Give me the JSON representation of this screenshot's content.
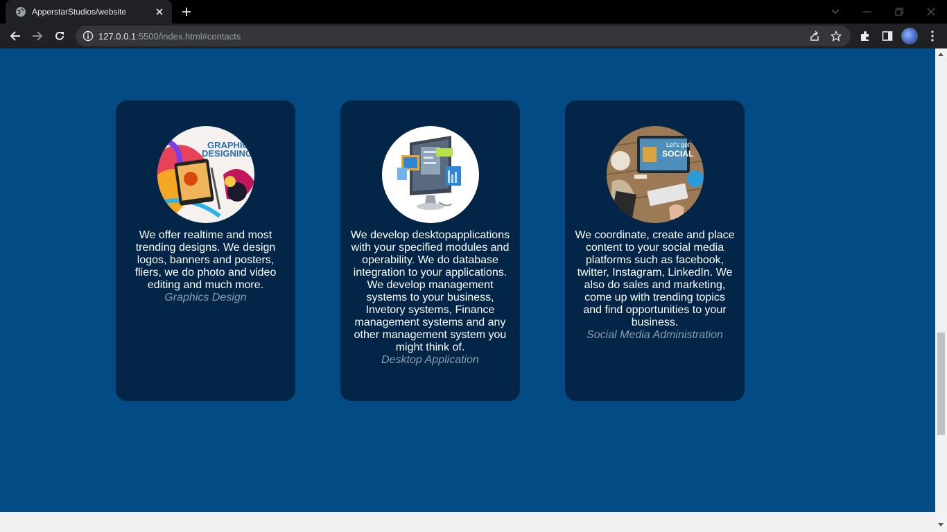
{
  "browser": {
    "tab_title": "ApperstarStudios/website",
    "url_host": "127.0.0.1",
    "url_rest": ":5500/index.html#contacts"
  },
  "services": [
    {
      "description": "We offer realtime and most trending designs. We design logos, banners and posters, fliers, we do photo and video editing and much more.",
      "caption": "Graphics Design",
      "image_text": "GRAPHIC DESIGNING"
    },
    {
      "description": "We develop desktopapplications with your specified modules and operability. We do database integration to your applications. We develop management systems to your business, Invetory systems, Finance management systems and any other management system you might think of.",
      "caption": "Desktop Application"
    },
    {
      "description": "We coordinate, create and place content to your social media platforms such as facebook, twitter, Instagram, LinkedIn. We also do sales and marketing, come up with trending topics and find opportunities to your business.",
      "caption": "Social Media Administration",
      "image_text": "Let's get SOCIAL"
    }
  ],
  "colors": {
    "page_bg": "#034b84",
    "card_bg": "#022548",
    "caption": "#8a9bb0"
  }
}
